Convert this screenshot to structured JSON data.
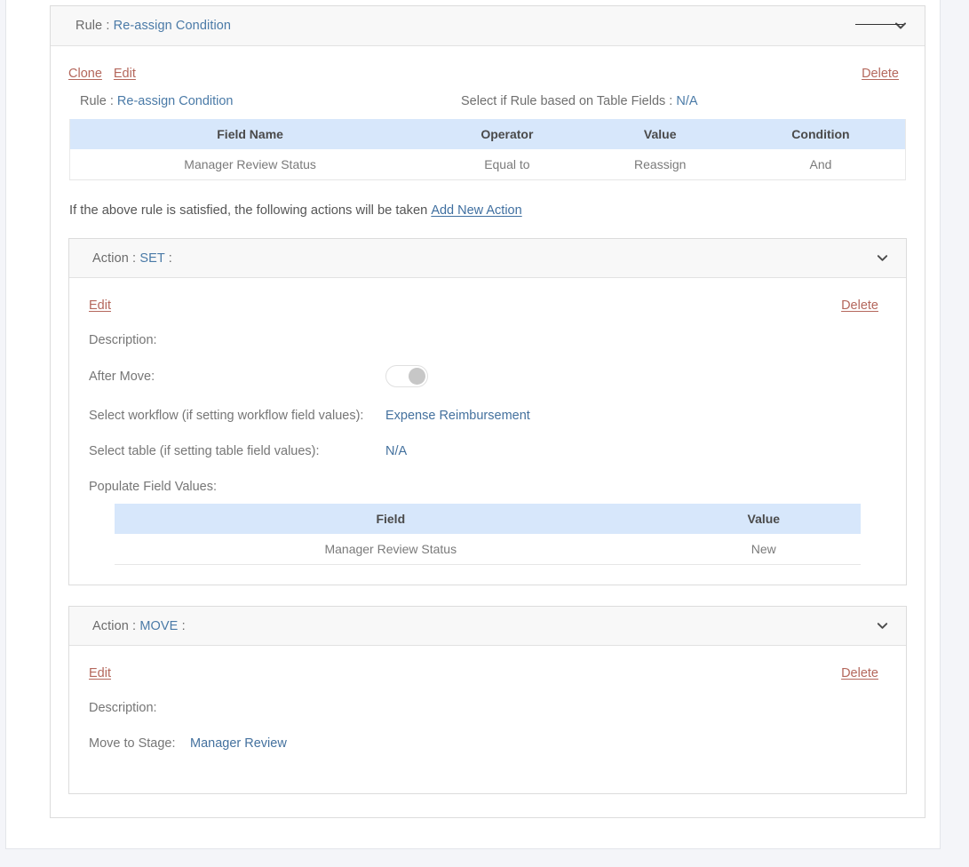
{
  "rule_panel": {
    "header_label": "Rule :",
    "header_name": "Re-assign Condition",
    "clone_label": "Clone",
    "edit_label": "Edit",
    "delete_label": "Delete",
    "rule_label": "Rule :",
    "rule_name": "Re-assign Condition",
    "table_fields_label": "Select if Rule based on Table Fields :",
    "table_fields_value": "N/A",
    "condition_table": {
      "headers": [
        "Field Name",
        "Operator",
        "Value",
        "Condition"
      ],
      "rows": [
        [
          "Manager Review Status",
          "Equal to",
          "Reassign",
          "And"
        ]
      ]
    },
    "satisfied_text": "If the above rule is satisfied, the following actions will be taken",
    "add_action_label": "Add New Action"
  },
  "set_action": {
    "header_label": "Action :",
    "header_type": "SET",
    "header_suffix": ":",
    "edit_label": "Edit",
    "delete_label": "Delete",
    "description_label": "Description:",
    "description_value": "",
    "after_move_label": "After Move:",
    "after_move_state": "off",
    "select_workflow_label": "Select workflow (if setting workflow field values):",
    "select_workflow_value": "Expense Reimbursement",
    "select_table_label": "Select table (if setting table field values):",
    "select_table_value": "N/A",
    "populate_label": "Populate Field Values:",
    "field_values_table": {
      "headers": [
        "Field",
        "Value"
      ],
      "rows": [
        [
          "Manager Review Status",
          "New"
        ]
      ]
    }
  },
  "move_action": {
    "header_label": "Action :",
    "header_type": "MOVE",
    "header_suffix": ":",
    "edit_label": "Edit",
    "delete_label": "Delete",
    "description_label": "Description:",
    "description_value": "",
    "move_to_stage_label": "Move to Stage:",
    "move_to_stage_value": "Manager Review"
  },
  "icons": {
    "collapse_chevron": "chevron-down-icon"
  },
  "colors": {
    "accent_blue": "#4a7aa7",
    "danger_link": "#b4675c",
    "table_header_blue": "#d7e7fb",
    "panel_header_gray": "#f8f8f8",
    "page_background": "#f4f5f9"
  }
}
